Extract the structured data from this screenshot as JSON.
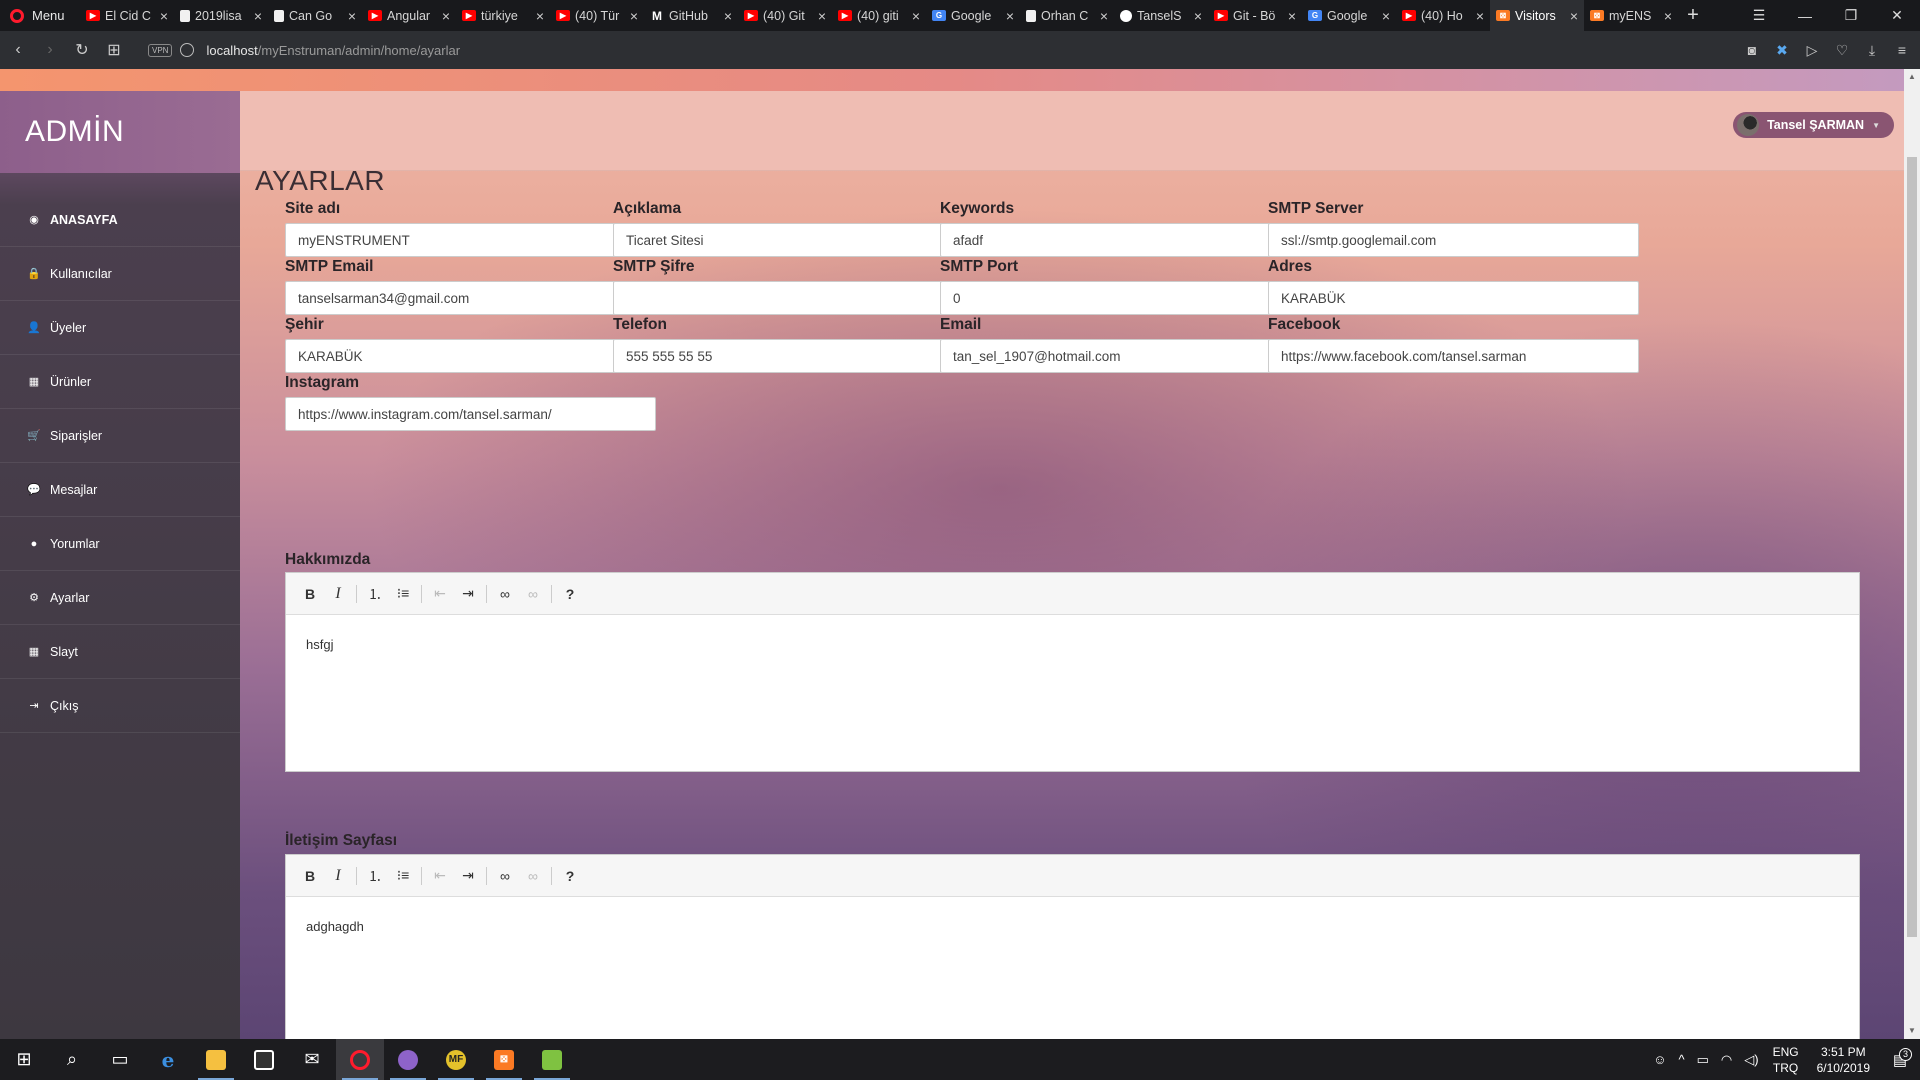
{
  "browser": {
    "menu_label": "Menu",
    "tabs": [
      {
        "title": "El Cid C",
        "icon": "youtube-icon"
      },
      {
        "title": "2019lisa",
        "icon": "document-icon"
      },
      {
        "title": "Can Go",
        "icon": "document-icon"
      },
      {
        "title": "Angular",
        "icon": "youtube-icon"
      },
      {
        "title": "türkiye",
        "icon": "youtube-icon"
      },
      {
        "title": "(40) Tür",
        "icon": "youtube-icon"
      },
      {
        "title": "GitHub",
        "icon": "gmail-icon"
      },
      {
        "title": "(40) Git",
        "icon": "youtube-icon"
      },
      {
        "title": "(40) giti",
        "icon": "youtube-icon"
      },
      {
        "title": "Google",
        "icon": "google-translate-icon"
      },
      {
        "title": "Orhan C",
        "icon": "document-icon"
      },
      {
        "title": "TanselS",
        "icon": "github-icon"
      },
      {
        "title": "Git - Bö",
        "icon": "youtube-icon"
      },
      {
        "title": "Google",
        "icon": "google-translate-icon"
      },
      {
        "title": "(40) Ho",
        "icon": "youtube-icon"
      },
      {
        "title": "Visitors",
        "icon": "xampp-icon"
      },
      {
        "title": "myENS",
        "icon": "xampp-icon"
      }
    ],
    "url_host": "localhost",
    "url_path": "/myEnstruman/admin/home/ayarlar",
    "vpn_label": "VPN"
  },
  "sidebar": {
    "brand": "ADMİN",
    "items": [
      {
        "label": "ANASAYFA",
        "icon": "dashboard-icon"
      },
      {
        "label": "Kullanıcılar",
        "icon": "lock-icon"
      },
      {
        "label": "Üyeler",
        "icon": "user-icon"
      },
      {
        "label": "Ürünler",
        "icon": "grid-icon"
      },
      {
        "label": "Siparişler",
        "icon": "cart-icon"
      },
      {
        "label": "Mesajlar",
        "icon": "chat-icon"
      },
      {
        "label": "Yorumlar",
        "icon": "comment-icon"
      },
      {
        "label": "Ayarlar",
        "icon": "gear-icon"
      },
      {
        "label": "Slayt",
        "icon": "grid-icon"
      },
      {
        "label": "Çıkış",
        "icon": "logout-icon"
      }
    ]
  },
  "header": {
    "user_name": "Tansel ŞARMAN"
  },
  "page": {
    "title": "AYARLAR",
    "fields": [
      {
        "label": "Site adı",
        "value": "myENSTRUMENT"
      },
      {
        "label": "Açıklama",
        "value": "Ticaret Sitesi"
      },
      {
        "label": "Keywords",
        "value": "afadf"
      },
      {
        "label": "SMTP Server",
        "value": "ssl://smtp.googlemail.com"
      },
      {
        "label": "SMTP Email",
        "value": "tanselsarman34@gmail.com"
      },
      {
        "label": "SMTP Şifre",
        "value": ""
      },
      {
        "label": "SMTP Port",
        "value": "0"
      },
      {
        "label": "Adres",
        "value": "KARABÜK"
      },
      {
        "label": "Şehir",
        "value": "KARABÜK"
      },
      {
        "label": "Telefon",
        "value": "555 555 55 55"
      },
      {
        "label": "Email",
        "value": "tan_sel_1907@hotmail.com"
      },
      {
        "label": "Facebook",
        "value": "https://www.facebook.com/tansel.sarman"
      },
      {
        "label": "Instagram",
        "value": "https://www.instagram.com/tansel.sarman/"
      }
    ],
    "about": {
      "label": "Hakkımızda",
      "content": "hsfgj"
    },
    "contact": {
      "label": "İletişim Sayfası",
      "content": "adghagdh"
    }
  },
  "taskbar": {
    "lang_primary": "ENG",
    "lang_secondary": "TRQ",
    "time": "3:51 PM",
    "date": "6/10/2019",
    "notification_count": "3"
  }
}
